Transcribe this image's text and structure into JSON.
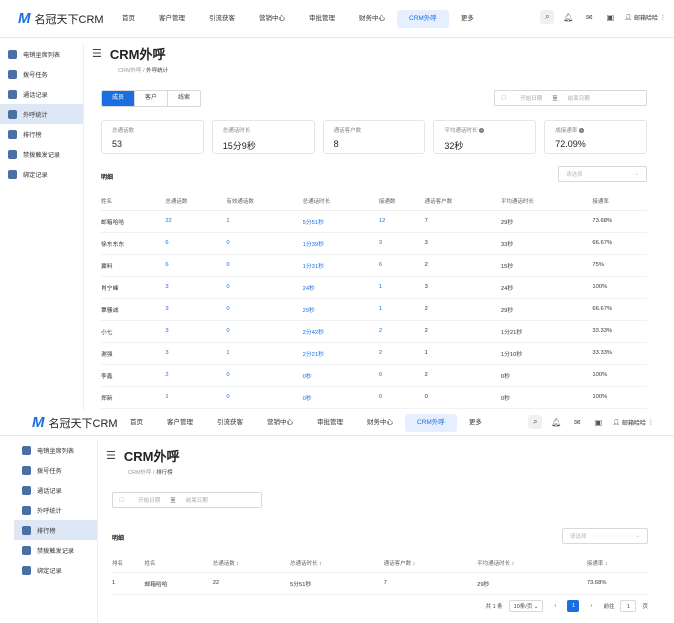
{
  "app": {
    "brand": "名冠天下CRM"
  },
  "nav": [
    "首页",
    "客户管理",
    "引流获客",
    "营销中心",
    "审批管理",
    "财务中心",
    "CRM外呼",
    "更多"
  ],
  "user": {
    "name": "邮箱哈哈"
  },
  "sidebar": [
    "电销坐席列表",
    "拨号任务",
    "通话记录",
    "外呼统计",
    "排行榜",
    "禁拨触发记录",
    "绑定记录"
  ],
  "page": {
    "title": "CRM外呼",
    "crumb_root": "CRM外呼",
    "crumb_s1": "外呼统计",
    "crumb_s2": "排行榜"
  },
  "tabs": [
    "成员",
    "客户",
    "线索"
  ],
  "daterange": {
    "start": "开始日期",
    "sep": "至",
    "end": "结束日期"
  },
  "cards": [
    {
      "label": "总通话数",
      "value": "53"
    },
    {
      "label": "总通话时长",
      "value": "15分9秒"
    },
    {
      "label": "通话客户数",
      "value": "8"
    },
    {
      "label": "平均通话时长",
      "value": "32秒"
    },
    {
      "label": "成接通率",
      "value": "72.09%"
    }
  ],
  "section": {
    "label": "明细",
    "select_placeholder": "请选择"
  },
  "stats_table": {
    "headers": [
      "姓名",
      "总通话数",
      "有效通话数",
      "总通话时长",
      "接通数",
      "通话客户数",
      "平均通话时长",
      "接通率"
    ],
    "rows": [
      [
        "邮箱哈哈",
        "22",
        "1",
        "5分51秒",
        "12",
        "7",
        "29秒",
        "73.68%"
      ],
      [
        "徐东东东",
        "6",
        "0",
        "1分39秒",
        "3",
        "3",
        "33秒",
        "66.67%"
      ],
      [
        "翼料",
        "6",
        "0",
        "1分31秒",
        "6",
        "2",
        "15秒",
        "75%"
      ],
      [
        "肖宁峰",
        "3",
        "0",
        "24秒",
        "1",
        "3",
        "24秒",
        "100%"
      ],
      [
        "覃骚诚",
        "3",
        "0",
        "29秒",
        "1",
        "2",
        "29秒",
        "66.67%"
      ],
      [
        "小七",
        "3",
        "0",
        "2分42秒",
        "2",
        "2",
        "1分21秒",
        "33.33%"
      ],
      [
        "谢强",
        "3",
        "1",
        "2分21秒",
        "2",
        "1",
        "1分10秒",
        "33.33%"
      ],
      [
        "李鑫",
        "2",
        "0",
        "0秒",
        "0",
        "2",
        "0秒",
        "100%"
      ],
      [
        "郑新",
        "1",
        "0",
        "0秒",
        "0",
        "0",
        "0秒",
        "100%"
      ]
    ]
  },
  "rank_table": {
    "headers": [
      "排名",
      "姓名",
      "总通话数 ↕",
      "总通话时长 ↕",
      "通话客户数 ↕",
      "平均通话时长 ↕",
      "接通率 ↕"
    ],
    "rows": [
      [
        "1",
        "邮箱哈哈",
        "22",
        "5分51秒",
        "7",
        "29秒",
        "73.68%"
      ]
    ]
  },
  "pager": {
    "total": "共 1 条",
    "size": "10条/页",
    "page": "1",
    "goto": "前往",
    "goto_val": "1",
    "page_unit": "页"
  },
  "colors": {
    "accent": "#1a6fe0",
    "sidebar_active": "#dde7f5"
  }
}
